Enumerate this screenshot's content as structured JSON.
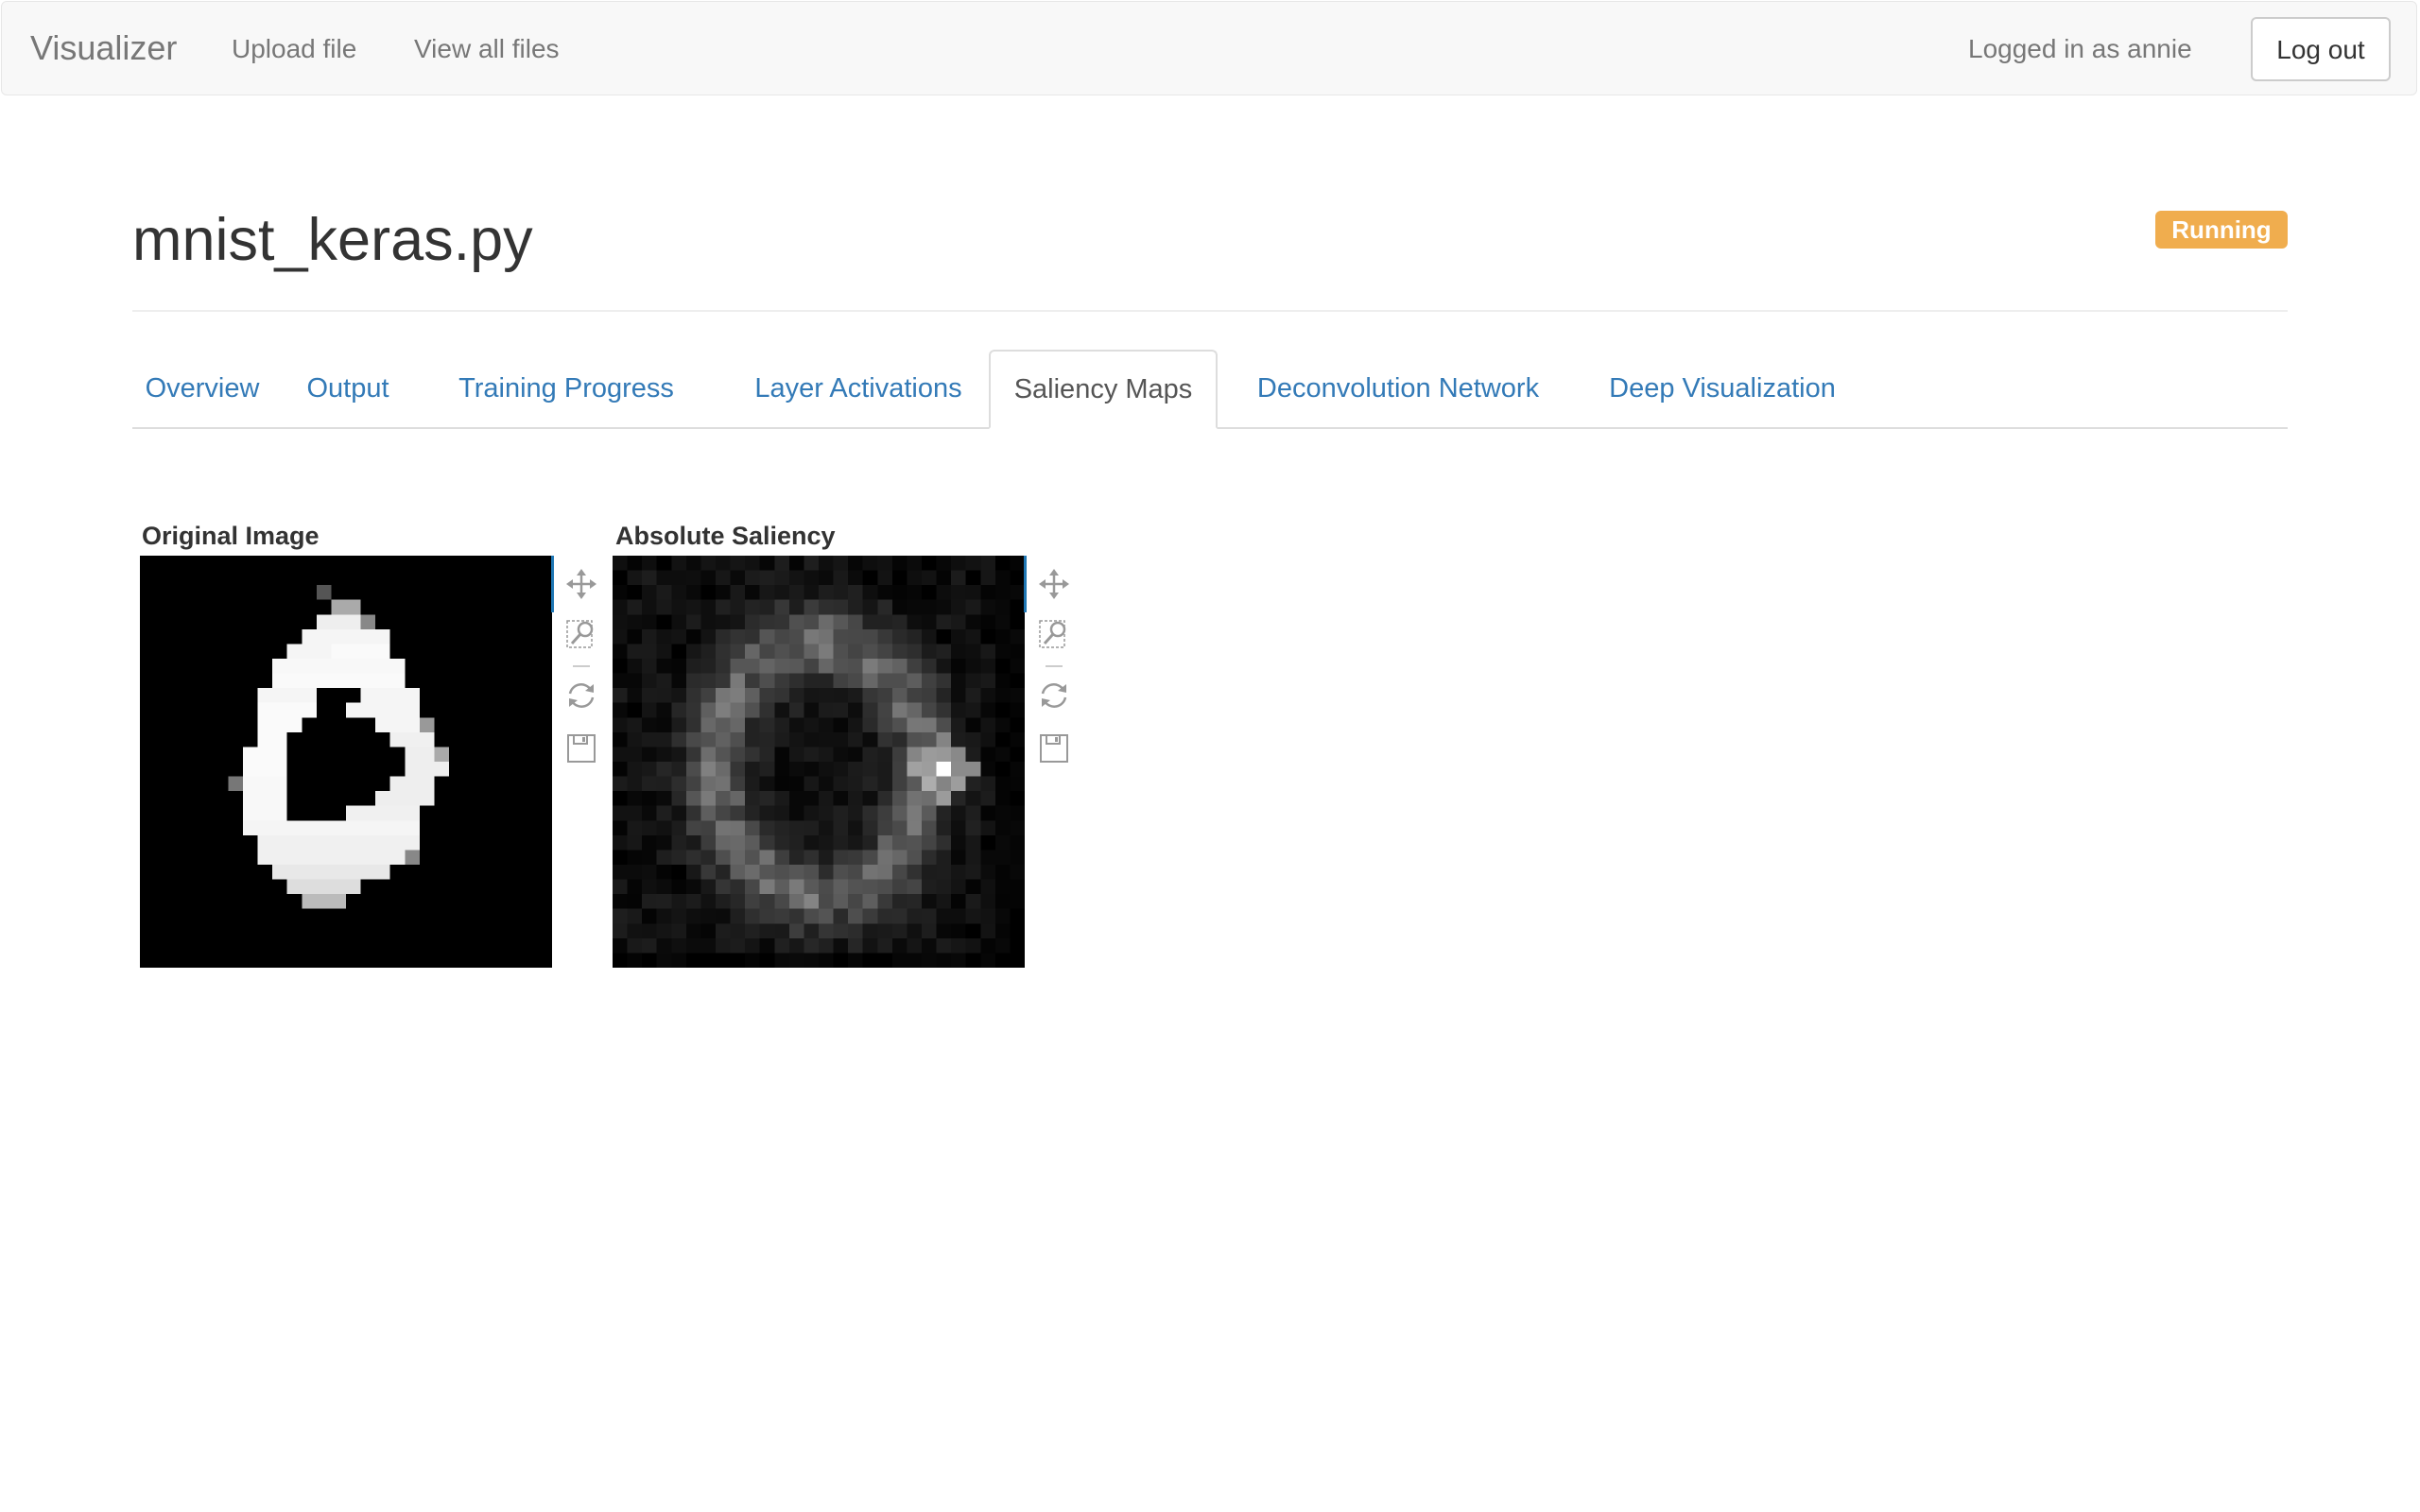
{
  "navbar": {
    "brand": "Visualizer",
    "links": [
      "Upload file",
      "View all files"
    ],
    "user_text": "Logged in as annie",
    "logout_label": "Log out"
  },
  "page": {
    "title": "mnist_keras.py",
    "status": "Running"
  },
  "tabs": [
    {
      "label": "Overview"
    },
    {
      "label": "Output"
    },
    {
      "label": "Training Progress"
    },
    {
      "label": "Layer Activations"
    },
    {
      "label": "Saliency Maps",
      "active": true
    },
    {
      "label": "Deconvolution Network"
    },
    {
      "label": "Deep Visualization"
    }
  ],
  "panels": [
    {
      "title": "Original Image",
      "tools": [
        "move-icon",
        "zoom-box-icon",
        "reset-icon",
        "save-icon"
      ]
    },
    {
      "title": "Absolute Saliency",
      "tools": [
        "move-icon",
        "zoom-box-icon",
        "reset-icon",
        "save-icon"
      ]
    }
  ],
  "colors": {
    "accent": "#337ab7",
    "badge": "#f0ad4e",
    "plot_edge": "#1f77b4"
  }
}
